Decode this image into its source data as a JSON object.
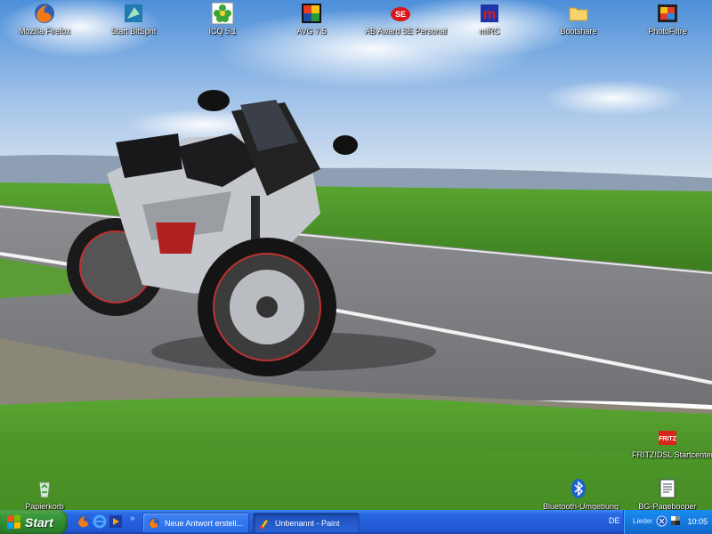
{
  "desktop": {
    "icons_top": [
      {
        "label": "Mozilla Firefox",
        "icon": "firefox-icon"
      },
      {
        "label": "Start BitSprit",
        "icon": "bitsprit-icon"
      },
      {
        "label": "ICQ 5.1",
        "icon": "icq-icon"
      },
      {
        "label": "AVG 7.5",
        "icon": "avg-icon"
      },
      {
        "label": "AB Award SE Personal",
        "icon": "ab-award-icon"
      },
      {
        "label": "mIRC",
        "icon": "mirc-icon"
      },
      {
        "label": "Bootshare",
        "icon": "folder-icon"
      },
      {
        "label": "PhotoFiltre",
        "icon": "photofiltre-icon"
      }
    ],
    "icon_fritz": {
      "label": "FRITZ!DSL Startcenter",
      "icon": "fritz-icon"
    },
    "icon_recycle": {
      "label": "Papierkorb",
      "icon": "recycle-bin-icon"
    },
    "icon_bluetooth": {
      "label": "Bluetooth-Umgebung",
      "icon": "bluetooth-icon"
    },
    "icon_bg": {
      "label": "BG-Pagebooper",
      "icon": "document-icon"
    }
  },
  "taskbar": {
    "start_label": "Start",
    "quick_launch": [
      "firefox-icon",
      "ie-icon",
      "media-player-icon",
      "avg-icon"
    ],
    "overflow": "»",
    "tasks": [
      {
        "label": "Neue Antwort erstell...",
        "icon": "firefox-icon",
        "active": false
      },
      {
        "label": "Unbenannt - Paint",
        "icon": "paint-icon",
        "active": true
      }
    ],
    "language": "DE",
    "tray_label": "Lieder",
    "clock": "10:05",
    "tray_icons": [
      "network-icon",
      "volume-icon"
    ]
  },
  "colors": {
    "taskbar_blue": "#245edb",
    "start_green": "#3c9b3c",
    "tray_blue": "#1479de"
  }
}
